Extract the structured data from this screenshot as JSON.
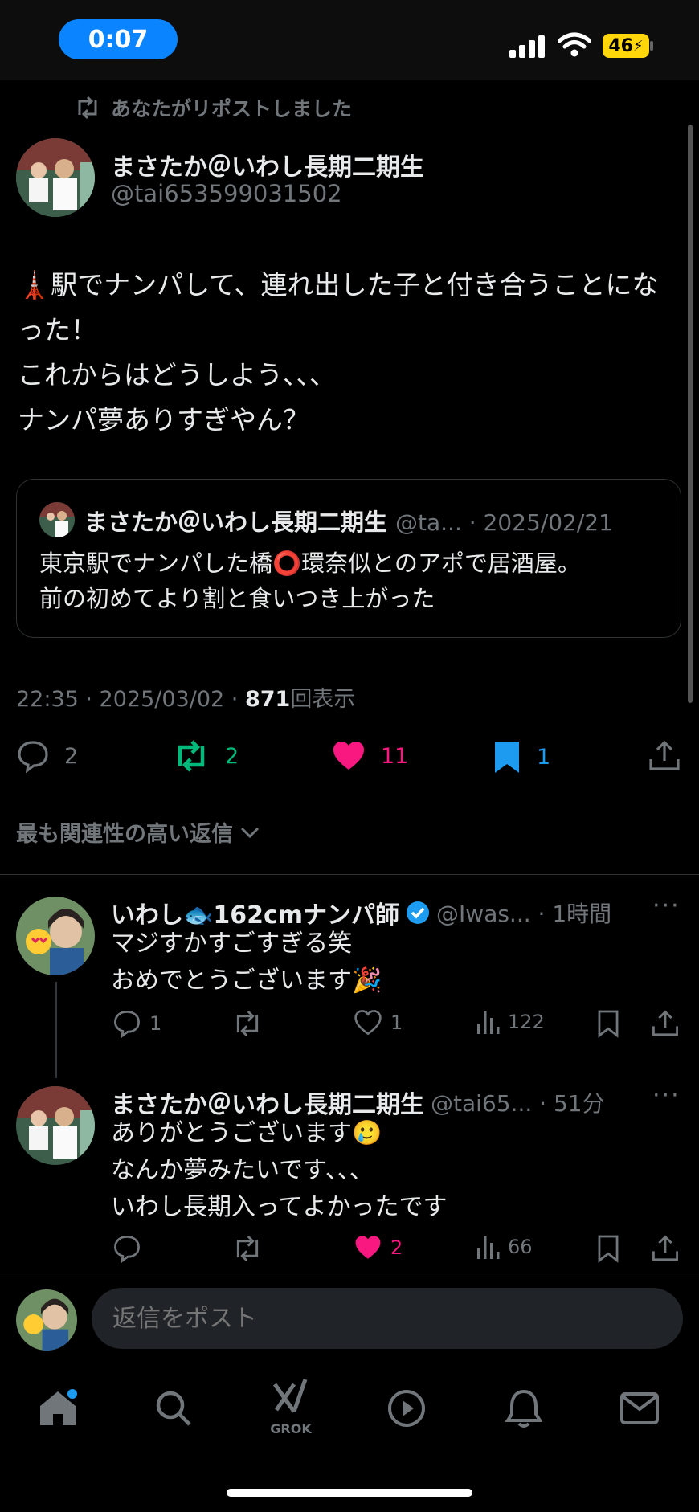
{
  "status_bar": {
    "time": "0:07",
    "battery": "46"
  },
  "repost_banner": "あなたがリポストしました",
  "tweet": {
    "author_name": "まさたか＠いわし長期二期生",
    "author_handle": "@tai653599031502",
    "text": "🗼駅でナンパして、連れ出した子と付き合うことになった！\nこれからはどうしよう、、、\nナンパ夢ありすぎやん？",
    "quote": {
      "author_name": "まさたか＠いわし長期二期生",
      "handle_date": "@ta... · 2025/02/21",
      "text": "東京駅でナンパした橋⭕環奈似とのアポで居酒屋。\n前の初めてより割と食いつき上がった"
    },
    "meta_time": "22:35 · 2025/03/02 · ",
    "meta_views": "871",
    "meta_views_label": "回表示",
    "replies": "2",
    "reposts": "2",
    "likes": "11",
    "bookmarks": "1",
    "colors": {
      "repost": "#00ba7c",
      "like": "#f91880",
      "bookmark": "#1d9bf0"
    }
  },
  "reply_sort_label": "最も関連性の高い返信",
  "replies": [
    {
      "name": "いわし🐟162cmナンパ師",
      "verified": true,
      "handle_time": "@Iwas... · 1時間",
      "text": "マジすかすごすぎる笑\nおめでとうございます🎉",
      "reply_count": "1",
      "repost_count": "",
      "like_count": "1",
      "view_count": "122",
      "liked": false
    },
    {
      "name": "まさたか＠いわし長期二期生",
      "verified": false,
      "handle_time": "@tai65... · 51分",
      "text": "ありがとうございます🥲\nなんか夢みたいです、、、\nいわし長期入ってよかったです",
      "reply_count": "",
      "repost_count": "",
      "like_count": "2",
      "view_count": "66",
      "liked": true
    }
  ],
  "composer": {
    "placeholder": "返信をポスト"
  },
  "bottom_nav": {
    "grok_label": "GROK"
  }
}
